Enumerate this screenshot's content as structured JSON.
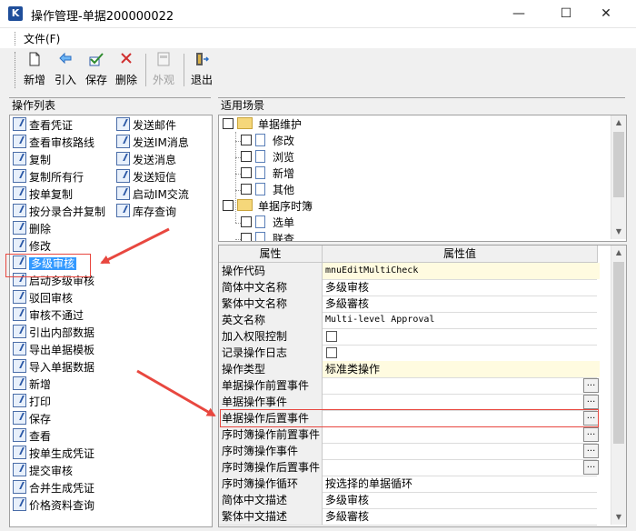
{
  "window": {
    "app_icon": "K",
    "title": "操作管理-单据200000022",
    "minimize_glyph": "—",
    "maximize_glyph": "☐",
    "close_glyph": "✕"
  },
  "menu": {
    "file": "文件(F)"
  },
  "toolbar": {
    "new_label": "新增",
    "import_label": "引入",
    "save_label": "保存",
    "delete_label": "删除",
    "appearance_label": "外观",
    "exit_label": "退出",
    "icons": {
      "new": "new-doc-icon",
      "import": "arrow-left-icon",
      "save": "save-check-icon",
      "delete": "delete-x-icon",
      "appearance": "appearance-icon",
      "exit": "exit-door-icon"
    },
    "delete_color": "#d03030"
  },
  "left_panel": {
    "title": "操作列表",
    "col1": [
      "查看凭证",
      "查看审核路线",
      "复制",
      "复制所有行",
      "按单复制",
      "按分录合并复制",
      "删除",
      "修改",
      "多级审核",
      "启动多级审核",
      "驳回审核",
      "审核不通过",
      "引出内部数据",
      "导出单据模板",
      "导入单据数据",
      "新增",
      "打印",
      "保存",
      "查看",
      "按单生成凭证",
      "提交审核",
      "合并生成凭证",
      "价格资料查询"
    ],
    "col2": [
      "发送邮件",
      "发送IM消息",
      "发送消息",
      "发送短信",
      "启动IM交流",
      "库存查询"
    ],
    "selected_item": "多级审核",
    "selection_color": "#3399ff"
  },
  "scene_panel": {
    "title": "适用场景",
    "nodes": [
      {
        "label": "单据维护",
        "type": "folder"
      },
      {
        "label": "修改",
        "type": "doc"
      },
      {
        "label": "浏览",
        "type": "doc"
      },
      {
        "label": "新增",
        "type": "doc"
      },
      {
        "label": "其他",
        "type": "doc"
      },
      {
        "label": "单据序时簿",
        "type": "folder"
      },
      {
        "label": "选单",
        "type": "doc"
      },
      {
        "label": "联查",
        "type": "doc"
      }
    ]
  },
  "property_grid": {
    "header_name": "属性",
    "header_value": "属性值",
    "rows": [
      {
        "name": "操作代码",
        "value": "mnuEditMultiCheck",
        "mono": true,
        "hl": true
      },
      {
        "name": "简体中文名称",
        "value": "多级审核"
      },
      {
        "name": "繁体中文名称",
        "value": "多級審核"
      },
      {
        "name": "英文名称",
        "value": "Multi-level Approval",
        "mono": true
      },
      {
        "name": "加入权限控制",
        "value": "",
        "checkbox": true
      },
      {
        "name": "记录操作日志",
        "value": "",
        "checkbox": true
      },
      {
        "name": "操作类型",
        "value": "标准类操作",
        "hl": true
      },
      {
        "name": "单据操作前置事件",
        "value": "",
        "ellipsis": true
      },
      {
        "name": "单据操作事件",
        "value": "",
        "ellipsis": true
      },
      {
        "name": "单据操作后置事件",
        "value": "",
        "ellipsis": true
      },
      {
        "name": "序时簿操作前置事件",
        "value": "",
        "ellipsis": true
      },
      {
        "name": "序时簿操作事件",
        "value": "",
        "ellipsis": true
      },
      {
        "name": "序时簿操作后置事件",
        "value": "",
        "ellipsis": true
      },
      {
        "name": "序时簿操作循环",
        "value": "按选择的单据循环"
      },
      {
        "name": "简体中文描述",
        "value": "多级审核"
      },
      {
        "name": "繁体中文描述",
        "value": "多級審核"
      }
    ],
    "ellipsis_glyph": "..."
  },
  "annotations": {
    "color": "#e8473f"
  }
}
